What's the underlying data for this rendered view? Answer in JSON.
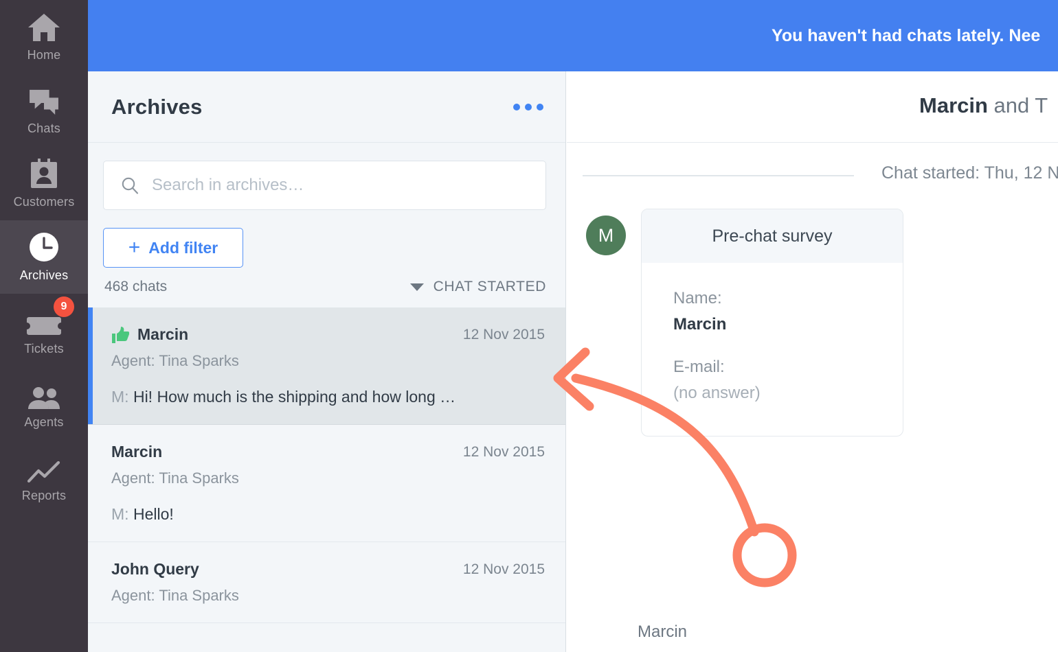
{
  "nav": {
    "items": [
      {
        "label": "Home",
        "icon": "home-icon",
        "active": false,
        "badge": null
      },
      {
        "label": "Chats",
        "icon": "chats-icon",
        "active": false,
        "badge": null
      },
      {
        "label": "Customers",
        "icon": "customers-icon",
        "active": false,
        "badge": null
      },
      {
        "label": "Archives",
        "icon": "clock-icon",
        "active": true,
        "badge": null
      },
      {
        "label": "Tickets",
        "icon": "ticket-icon",
        "active": false,
        "badge": "9"
      },
      {
        "label": "Agents",
        "icon": "agents-icon",
        "active": false,
        "badge": null
      },
      {
        "label": "Reports",
        "icon": "reports-icon",
        "active": false,
        "badge": null
      }
    ]
  },
  "banner": {
    "text": "You haven't had chats lately. Nee",
    "color": "#4480f0"
  },
  "archives": {
    "title": "Archives",
    "more_menu": "•••",
    "search": {
      "placeholder": "Search in archives…",
      "value": ""
    },
    "add_filter_label": "Add filter",
    "add_filter_plus": "+",
    "chat_count": "468 chats",
    "sort_label": "CHAT STARTED",
    "items": [
      {
        "name": "Marcin",
        "date": "12 Nov 2015",
        "agent": "Agent: Tina Sparks",
        "prefix": "M:",
        "snippet": "Hi! How much is the shipping and how long …",
        "rated": true,
        "selected": true
      },
      {
        "name": "Marcin",
        "date": "12 Nov 2015",
        "agent": "Agent: Tina Sparks",
        "prefix": "M:",
        "snippet": "Hello!",
        "rated": false,
        "selected": false
      },
      {
        "name": "John Query",
        "date": "12 Nov 2015",
        "agent": "Agent: Tina Sparks",
        "prefix": "",
        "snippet": "",
        "rated": false,
        "selected": false
      }
    ]
  },
  "detail": {
    "title_bold": "Marcin",
    "title_rest": " and T",
    "started": "Chat started: Thu, 12 N",
    "avatar_initial": "M",
    "survey": {
      "heading": "Pre-chat survey",
      "fields": [
        {
          "label": "Name:",
          "value": "Marcin",
          "empty": false
        },
        {
          "label": "E-mail:",
          "value": "(no answer)",
          "empty": true
        }
      ]
    },
    "sender_name": "Marcin"
  },
  "annotation": {
    "color": "#fb8165",
    "shapes": [
      "curved-arrow",
      "circle-highlight"
    ]
  },
  "colors": {
    "accent_blue": "#4184f3",
    "banner_blue": "#4480f0",
    "sidebar_dark": "#3d3740",
    "sidebar_active": "#4c4750",
    "panel_bg": "#f3f6f9",
    "selected_row": "#e1e6e9",
    "badge_red": "#f4523f",
    "avatar_green": "#4f7d5a",
    "thumb_green": "#4bc77d",
    "annotation_orange": "#fb8165"
  }
}
